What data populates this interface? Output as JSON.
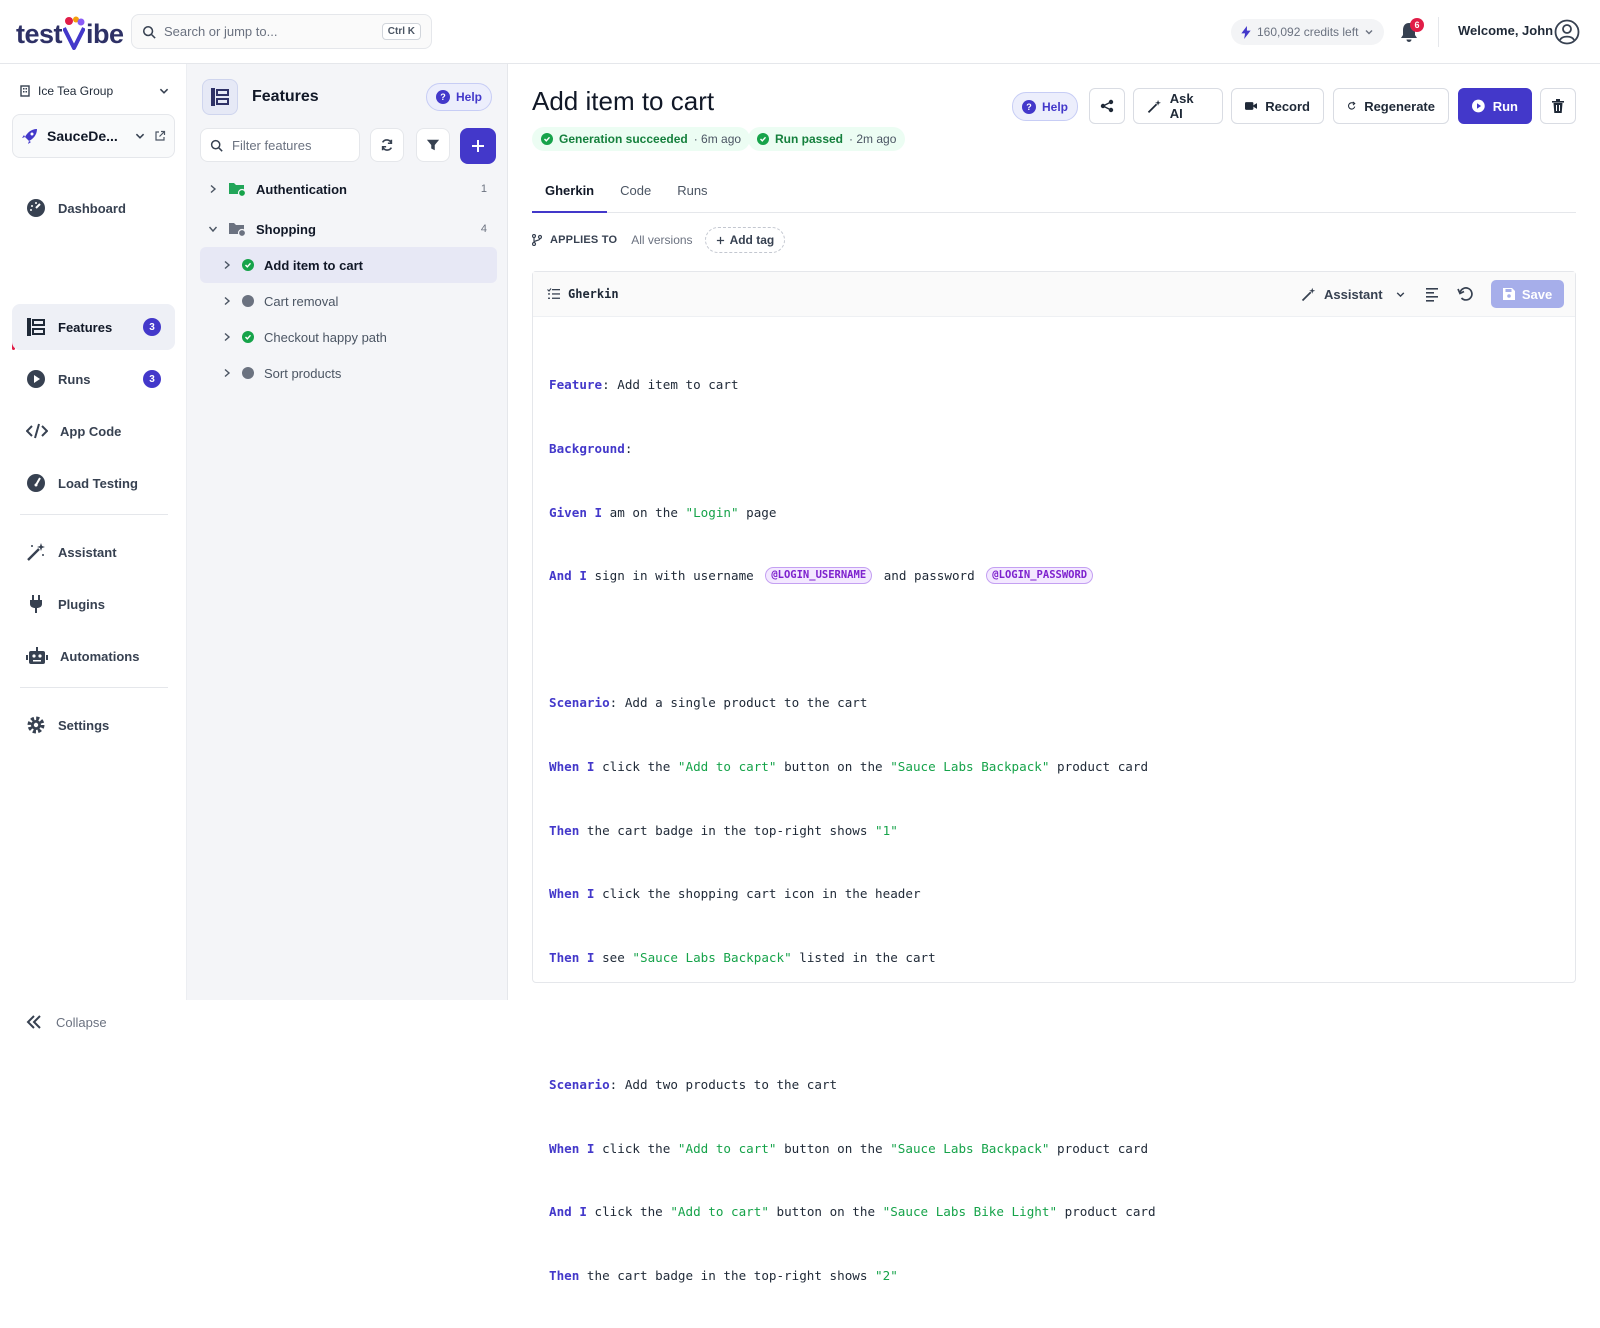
{
  "topbar": {
    "logo_left": "test",
    "logo_right": "ibe",
    "search_placeholder": "Search or jump to...",
    "search_shortcut": "Ctrl K",
    "credits": "160,092 credits left",
    "notif_count": "6",
    "welcome": "Welcome, John"
  },
  "nav": {
    "org": "Ice Tea Group",
    "project": "SauceDe...",
    "items": [
      {
        "label": "Dashboard",
        "icon": "dashboard-icon"
      },
      {
        "label": "Features",
        "badge": "3",
        "icon": "features-icon"
      },
      {
        "label": "Runs",
        "badge": "3",
        "icon": "runs-icon"
      },
      {
        "label": "App Code",
        "icon": "code-icon"
      },
      {
        "label": "Load Testing",
        "icon": "gauge-icon"
      },
      {
        "label": "Assistant",
        "icon": "magic-wand-icon"
      },
      {
        "label": "Plugins",
        "icon": "plug-icon"
      },
      {
        "label": "Automations",
        "icon": "robot-icon"
      },
      {
        "label": "Settings",
        "icon": "gear-icon"
      }
    ],
    "collapse": "Collapse"
  },
  "features": {
    "title": "Features",
    "help": "Help",
    "filter_placeholder": "Filter features",
    "tree": [
      {
        "label": "Authentication",
        "count": "1",
        "type": "folder"
      },
      {
        "label": "Shopping",
        "count": "4",
        "type": "folder"
      },
      {
        "label": "Add item to cart",
        "status": "passed"
      },
      {
        "label": "Cart removal",
        "status": "none"
      },
      {
        "label": "Checkout happy path",
        "status": "passed"
      },
      {
        "label": "Sort products",
        "status": "none"
      }
    ]
  },
  "main": {
    "title": "Add item to cart",
    "status1_label": "Generation succeeded",
    "status1_time": "· 6m ago",
    "status2_label": "Run passed",
    "status2_time": "· 2m ago",
    "help": "Help",
    "ask_ai": "Ask AI",
    "record": "Record",
    "regenerate": "Regenerate",
    "run": "Run",
    "tabs": [
      "Gherkin",
      "Code",
      "Runs"
    ],
    "applies_label": "APPLIES TO",
    "applies_value": "All versions",
    "add_tag": "Add tag",
    "editor": {
      "title": "Gherkin",
      "assistant": "Assistant",
      "save": "Save"
    }
  },
  "gherkin": {
    "l1": {
      "kw": "Feature",
      "rest": ": Add item to cart"
    },
    "l2": {
      "kw": "Background",
      "rest": ":"
    },
    "l3": {
      "kw": "Given I",
      "a": " am on the ",
      "s1": "\"Login\"",
      "b": " page"
    },
    "l4": {
      "kw": "And I",
      "a": " sign in with username ",
      "v1": "@LOGIN_USERNAME",
      "b": " and password ",
      "v2": "@LOGIN_PASSWORD"
    },
    "l6": {
      "kw": "Scenario",
      "rest": ": Add a single product to the cart"
    },
    "l7": {
      "kw": "When I",
      "a": " click the ",
      "s1": "\"Add to cart\"",
      "b": " button on the ",
      "s2": "\"Sauce Labs Backpack\"",
      "c": " product card"
    },
    "l8": {
      "kw": "Then",
      "a": " the cart badge in the top-right shows ",
      "s1": "\"1\""
    },
    "l9": {
      "kw": "When I",
      "a": " click the shopping cart icon in the header"
    },
    "l10": {
      "kw": "Then I",
      "a": " see ",
      "s1": "\"Sauce Labs Backpack\"",
      "b": " listed in the cart"
    },
    "l12": {
      "kw": "Scenario",
      "rest": ": Add two products to the cart"
    },
    "l13": {
      "kw": "When I",
      "a": " click the ",
      "s1": "\"Add to cart\"",
      "b": " button on the ",
      "s2": "\"Sauce Labs Backpack\"",
      "c": " product card"
    },
    "l14": {
      "kw": "And I",
      "a": " click the ",
      "s1": "\"Add to cart\"",
      "b": " button on the ",
      "s2": "\"Sauce Labs Bike Light\"",
      "c": " product card"
    },
    "l15": {
      "kw": "Then",
      "a": " the cart badge in the top-right shows ",
      "s1": "\"2\""
    }
  },
  "colors": {
    "accent": "#4338ca",
    "success": "#16a34a",
    "danger": "#e11d48"
  }
}
